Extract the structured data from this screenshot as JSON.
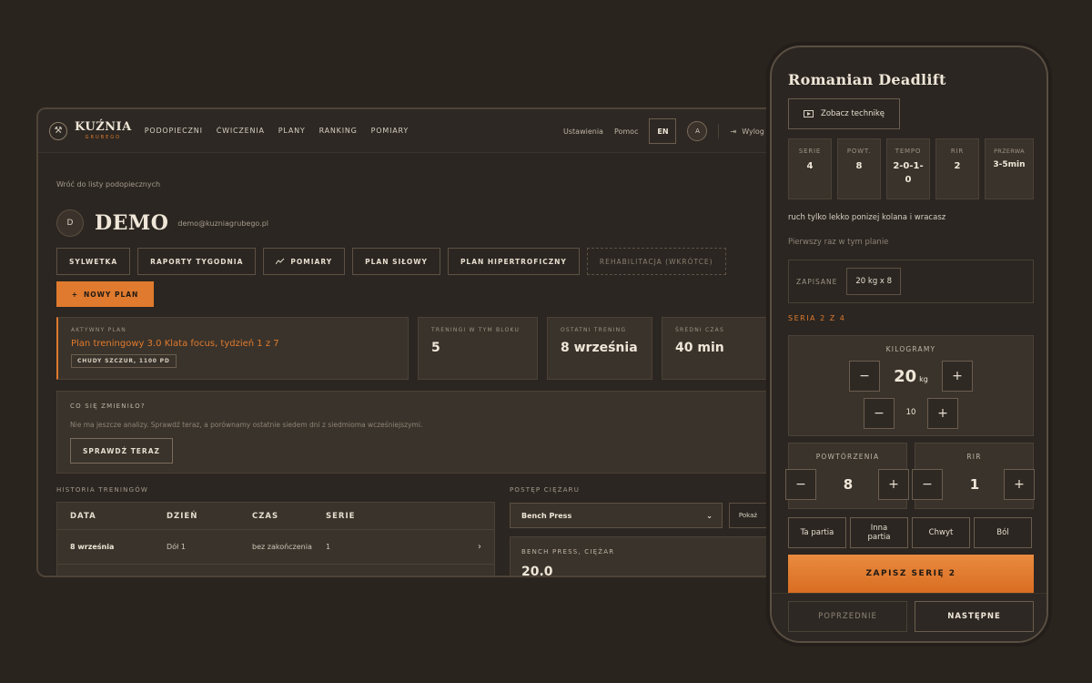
{
  "desktop": {
    "logo": {
      "title": "KUŹNIA",
      "subtitle": "GRUBEGO"
    },
    "nav": [
      "PODOPIECZNI",
      "ĆWICZENIA",
      "PLANY",
      "RANKING",
      "POMIARY"
    ],
    "nav_right": {
      "settings": "Ustawienia",
      "help": "Pomoc",
      "lang": "EN",
      "avatar": "A",
      "logout": "Wylog"
    },
    "back_link": "Wróć do listy podopiecznych",
    "profile": {
      "initial": "D",
      "name": "DEMO",
      "email": "demo@kuzniagrubego.pl"
    },
    "tabs": [
      "SYLWETKA",
      "RAPORTY TYGODNIA",
      "POMIARY",
      "PLAN SIŁOWY",
      "PLAN HIPERTROFICZNY",
      "REHABILITACJA (WKRÓTCE)"
    ],
    "new_plan": "NOWY PLAN",
    "active_plan": {
      "label": "AKTYWNY PLAN",
      "title": "Plan treningowy 3.0 Klata focus, tydzień 1 z 7",
      "badge": "CHUDY SZCZUR, 1100 PD"
    },
    "stats": [
      {
        "label": "TRENINGI W TYM BLOKU",
        "value": "5"
      },
      {
        "label": "OSTATNI TRENING",
        "value": "8 września"
      },
      {
        "label": "ŚREDNI CZAS",
        "value": "40 min"
      }
    ],
    "changes": {
      "title": "CO SIĘ ZMIENIŁO?",
      "desc": "Nie ma jeszcze analizy. Sprawdź teraz, a porównamy ostatnie siedem dni z siedmioma wcześniejszymi.",
      "button": "SPRAWDŹ TERAZ"
    },
    "history": {
      "label": "HISTORIA TRENINGÓW",
      "headers": [
        "DATA",
        "DZIEŃ",
        "CZAS",
        "SERIE"
      ],
      "rows": [
        {
          "date": "8 września",
          "day": "Dół 1",
          "time": "bez zakończenia",
          "series": "1"
        }
      ]
    },
    "progress": {
      "label": "POSTĘP CIĘŻARU",
      "select": "Bench Press",
      "show": "Pokaż",
      "chart_label": "BENCH PRESS, CIĘŻAR",
      "chart_value": "20,0"
    }
  },
  "phone": {
    "title": "Romanian Deadlift",
    "technique_button": "Zobacz technikę",
    "stats": [
      {
        "label": "SERIE",
        "value": "4"
      },
      {
        "label": "POWT.",
        "value": "8"
      },
      {
        "label": "TEMPO",
        "value": "2-0-1-0"
      },
      {
        "label": "RIR",
        "value": "2"
      },
      {
        "label": "PRZERWA",
        "value": "3-5min"
      }
    ],
    "note": "ruch tylko lekko ponizej kolana i wracasz",
    "first_time": "Pierwszy raz w tym planie",
    "saved": {
      "label": "ZAPISANE",
      "value": "20 kg x 8"
    },
    "series_label": "SERIA 2 Z 4",
    "kg": {
      "label": "KILOGRAMY",
      "value": "20",
      "unit": "kg",
      "step": "10"
    },
    "reps": {
      "label": "POWTÓRZENIA",
      "value": "8"
    },
    "rir": {
      "label": "RIR",
      "value": "1"
    },
    "chips": [
      "Ta partia",
      "Inna partia",
      "Chwyt",
      "Ból"
    ],
    "save_button": "ZAPISZ SERIĘ 2",
    "prev_button": "POPRZEDNIE",
    "next_button": "NASTĘPNE"
  },
  "colors": {
    "accent": "#e07a2e",
    "bg": "#2a241f",
    "card": "#3a332b"
  }
}
